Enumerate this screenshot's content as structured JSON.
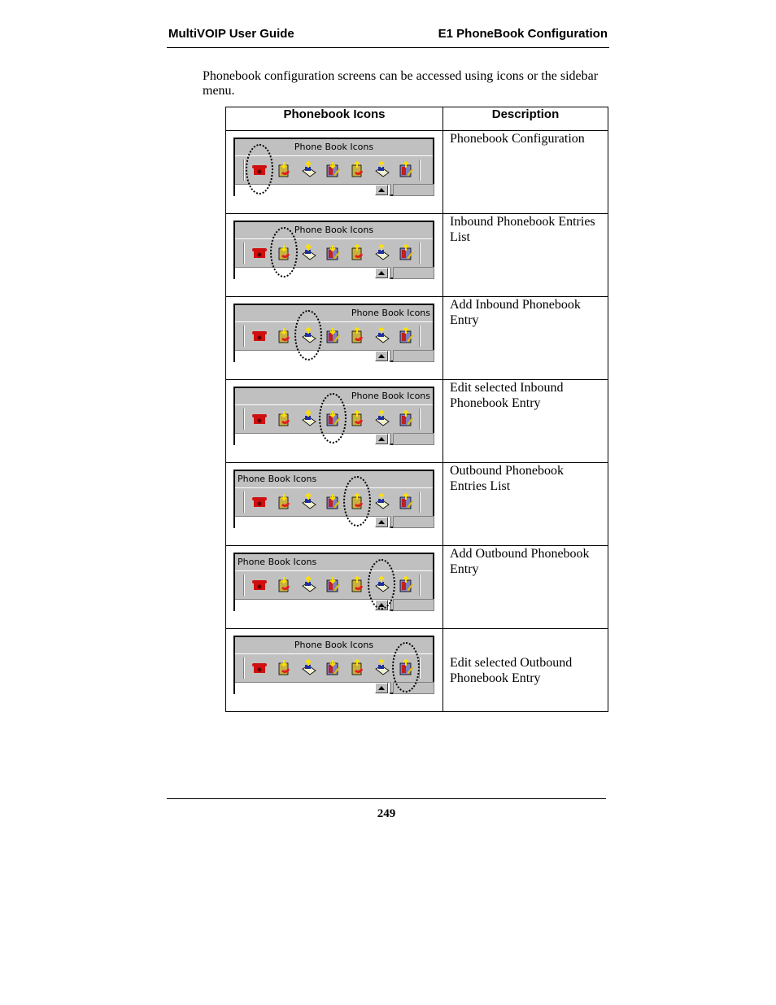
{
  "header": {
    "left": "MultiVOIP User Guide",
    "right": "E1 PhoneBook Configuration"
  },
  "intro": "Phonebook configuration screens can be accessed using icons or the sidebar menu.",
  "table": {
    "columns": [
      "Phonebook Icons",
      "Description"
    ],
    "toolbar_title": "Phone Book Icons",
    "toolbar_icons": [
      {
        "name": "phonebook-configuration",
        "icon": "red-telephone-icon"
      },
      {
        "name": "inbound-phonebook-list",
        "icon": "inbound-list-icon"
      },
      {
        "name": "add-inbound-entry",
        "icon": "add-inbound-book-icon"
      },
      {
        "name": "edit-inbound-entry",
        "icon": "edit-inbound-icon"
      },
      {
        "name": "outbound-phonebook-list",
        "icon": "outbound-list-icon"
      },
      {
        "name": "add-outbound-entry",
        "icon": "add-outbound-book-icon"
      },
      {
        "name": "edit-outbound-entry",
        "icon": "edit-outbound-icon"
      }
    ],
    "rows": [
      {
        "description": "Phonebook Configuration",
        "highlighted_icon": 1,
        "title_align": "center"
      },
      {
        "description": "Inbound Phonebook Entries List",
        "highlighted_icon": 2,
        "title_align": "center"
      },
      {
        "description": "Add Inbound Phonebook Entry",
        "highlighted_icon": 3,
        "title_align": "right"
      },
      {
        "description": "Edit selected Inbound Phonebook Entry",
        "highlighted_icon": 4,
        "title_align": "right"
      },
      {
        "description": "Outbound Phonebook Entries List",
        "highlighted_icon": 5,
        "title_align": "left"
      },
      {
        "description": "Add Outbound Phonebook Entry",
        "highlighted_icon": 6,
        "title_align": "left"
      },
      {
        "description": "Edit selected Outbound Phonebook Entry",
        "highlighted_icon": 7,
        "title_align": "center"
      }
    ]
  },
  "footer": {
    "page_number": "249"
  }
}
